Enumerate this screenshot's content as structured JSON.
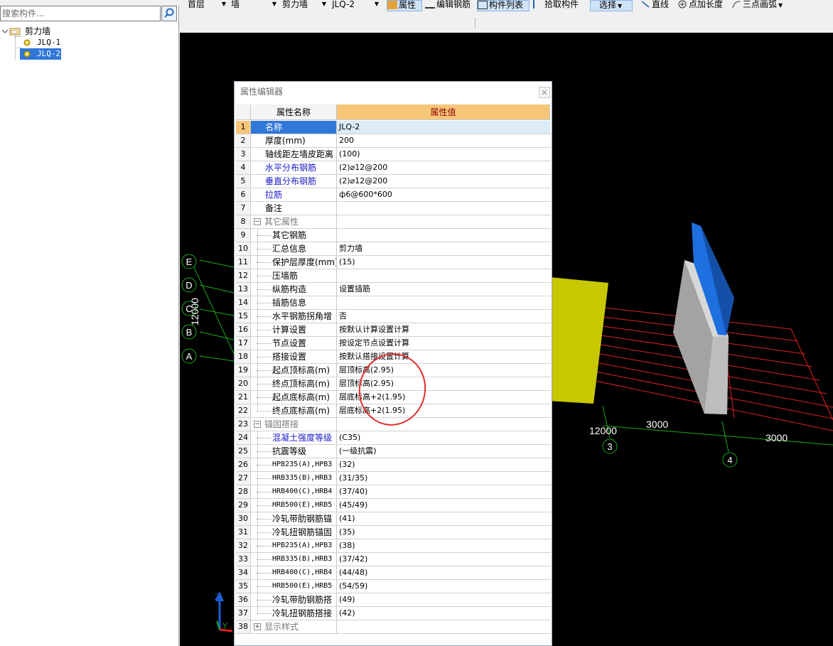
{
  "left_panel": {
    "search_placeholder": "搜索构件...",
    "tree": {
      "root": "剪力墙",
      "items": [
        "JLQ-1",
        "JLQ-2"
      ],
      "selected": "JLQ-2"
    }
  },
  "toolbar": {
    "floor": "首层",
    "category": "墙",
    "type": "剪力墙",
    "component": "JLQ-2",
    "btn_property": "属性",
    "btn_edit_rebar": "编辑钢筋",
    "btn_component_list": "构件列表",
    "btn_pick": "拾取构件",
    "btn_select": "选择",
    "btn_line": "直线",
    "btn_point_length": "点加长度",
    "btn_arc": "三点画弧"
  },
  "viewport": {
    "axis_labels": [
      "E",
      "D",
      "C",
      "B",
      "A"
    ],
    "dim_vertical": "12000",
    "dim_12000": "12000",
    "dim_3000a": "3000",
    "dim_3000b": "3000",
    "grid_3": "3",
    "grid_4": "4",
    "axis_z": "Z",
    "axis_y": "Y",
    "colors": {
      "wall_yellow": "#c8c800",
      "wall_grey": "#a0a0a0",
      "wall_blue": "#1e6fe0",
      "grid_red": "#e02020",
      "axis_green": "#1fa81f"
    }
  },
  "property_editor": {
    "title": "属性编辑器",
    "col_name": "属性名称",
    "col_value": "属性值",
    "rows": [
      {
        "n": "1",
        "name": "名称",
        "value": "JLQ-2",
        "style": "sel"
      },
      {
        "n": "2",
        "name": "厚度(mm)",
        "value": "200",
        "style": ""
      },
      {
        "n": "3",
        "name": "轴线距左墙皮距离",
        "value": "(100)",
        "style": ""
      },
      {
        "n": "4",
        "name": "水平分布钢筋",
        "value": "(2)⌀12@200",
        "style": "blue"
      },
      {
        "n": "5",
        "name": "垂直分布钢筋",
        "value": "(2)⌀12@200",
        "style": "blue"
      },
      {
        "n": "6",
        "name": "拉筋",
        "value": "ф6@600*600",
        "style": "blue"
      },
      {
        "n": "7",
        "name": "备注",
        "value": "",
        "style": ""
      },
      {
        "n": "8",
        "name": "其它属性",
        "value": "",
        "style": "group"
      },
      {
        "n": "9",
        "name": "其它钢筋",
        "value": "",
        "style": "child"
      },
      {
        "n": "10",
        "name": "汇总信息",
        "value": "剪力墙",
        "style": "child"
      },
      {
        "n": "11",
        "name": "保护层厚度(mm)",
        "value": "(15)",
        "style": "child"
      },
      {
        "n": "12",
        "name": "压墙筋",
        "value": "",
        "style": "child"
      },
      {
        "n": "13",
        "name": "纵筋构造",
        "value": "设置插筋",
        "style": "child"
      },
      {
        "n": "14",
        "name": "插筋信息",
        "value": "",
        "style": "child"
      },
      {
        "n": "15",
        "name": "水平钢筋拐角增",
        "value": "否",
        "style": "child"
      },
      {
        "n": "16",
        "name": "计算设置",
        "value": "按默认计算设置计算",
        "style": "child"
      },
      {
        "n": "17",
        "name": "节点设置",
        "value": "按设定节点设置计算",
        "style": "child"
      },
      {
        "n": "18",
        "name": "搭接设置",
        "value": "按默认搭接设置计算",
        "style": "child"
      },
      {
        "n": "19",
        "name": "起点顶标高(m)",
        "value": "层顶标高(2.95)",
        "style": "child"
      },
      {
        "n": "20",
        "name": "终点顶标高(m)",
        "value": "层顶标高(2.95)",
        "style": "child"
      },
      {
        "n": "21",
        "name": "起点底标高(m)",
        "value": "层底标高+2(1.95)",
        "style": "child"
      },
      {
        "n": "22",
        "name": "终点底标高(m)",
        "value": "层底标高+2(1.95)",
        "style": "child"
      },
      {
        "n": "23",
        "name": "锚固搭接",
        "value": "",
        "style": "group"
      },
      {
        "n": "24",
        "name": "混凝土强度等级",
        "value": "(C35)",
        "style": "child-blue"
      },
      {
        "n": "25",
        "name": "抗震等级",
        "value": "(一级抗震)",
        "style": "child"
      },
      {
        "n": "26",
        "name": "HPB235(A),HPB3",
        "value": "(32)",
        "style": "child-mono"
      },
      {
        "n": "27",
        "name": "HRB335(B),HRB3",
        "value": "(31/35)",
        "style": "child-mono"
      },
      {
        "n": "28",
        "name": "HRB400(C),HRB4",
        "value": "(37/40)",
        "style": "child-mono"
      },
      {
        "n": "29",
        "name": "HRB500(E),HRB5",
        "value": "(45/49)",
        "style": "child-mono"
      },
      {
        "n": "30",
        "name": "冷轧带肋钢筋锚",
        "value": "(41)",
        "style": "child"
      },
      {
        "n": "31",
        "name": "冷轧扭钢筋锚固",
        "value": "(35)",
        "style": "child"
      },
      {
        "n": "32",
        "name": "HPB235(A),HPB3",
        "value": "(38)",
        "style": "child-mono"
      },
      {
        "n": "33",
        "name": "HRB335(B),HRB3",
        "value": "(37/42)",
        "style": "child-mono"
      },
      {
        "n": "34",
        "name": "HRB400(C),HRB4",
        "value": "(44/48)",
        "style": "child-mono"
      },
      {
        "n": "35",
        "name": "HRB500(E),HRB5",
        "value": "(54/59)",
        "style": "child-mono"
      },
      {
        "n": "36",
        "name": "冷轧带肋钢筋搭",
        "value": "(49)",
        "style": "child"
      },
      {
        "n": "37",
        "name": "冷轧扭钢筋搭接",
        "value": "(42)",
        "style": "child"
      },
      {
        "n": "38",
        "name": "显示样式",
        "value": "",
        "style": "group-collapsed"
      }
    ]
  }
}
